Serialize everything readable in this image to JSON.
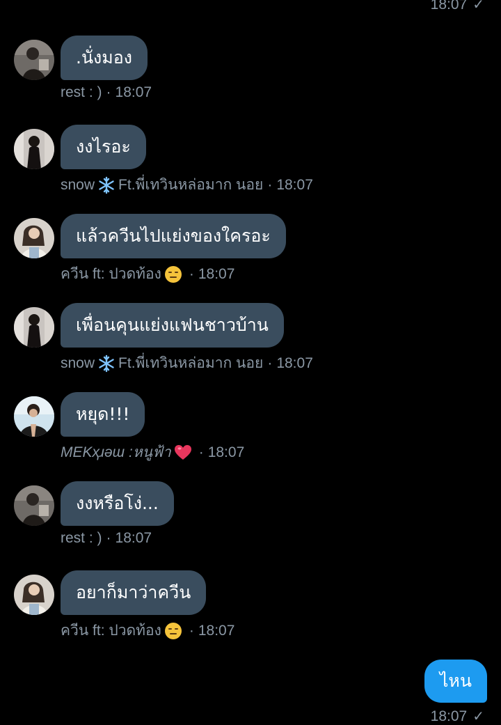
{
  "colors": {
    "background": "#000000",
    "received_bubble": "#3a4d5e",
    "sent_bubble": "#1d9bf0",
    "meta_text": "#8b98a5"
  },
  "top_receipt": {
    "time": "18:07",
    "status_icon": "check-icon"
  },
  "messages": [
    {
      "text": ".นั่งมอง",
      "sender": "rest : )",
      "time": "18:07",
      "avatar": "avatar-icon"
    },
    {
      "text": "งงไรอะ",
      "sender": "snow",
      "sender_suffix": "Ft.พี่เทวินหล่อมาก นอย",
      "emoji": "snowflake-icon",
      "time": "18:07",
      "avatar": "avatar-icon"
    },
    {
      "text": "แล้วควีนไปแย่งของใครอะ",
      "sender": "ควีน ft: ปวดท้อง",
      "emoji": "expressionless-face-icon",
      "time": "18:07",
      "avatar": "avatar-icon"
    },
    {
      "text": "เพื่อนคุนแย่งแฟนชาวบ้าน",
      "sender": "snow",
      "sender_suffix": "Ft.พี่เทวินหล่อมาก นอย",
      "emoji": "snowflake-icon",
      "time": "18:07",
      "avatar": "avatar-icon"
    },
    {
      "text": "หยุด!!!",
      "sender": "MEKҳɹəɯ :หนูฟ้า",
      "emoji": "heart-icon",
      "time": "18:07",
      "avatar": "avatar-icon"
    },
    {
      "text": "งงหรือโง่...",
      "sender": "rest : )",
      "time": "18:07",
      "avatar": "avatar-icon"
    },
    {
      "text": "อยาก็มาว่าควีน",
      "sender": "ควีน ft: ปวดท้อง",
      "emoji": "expressionless-face-icon",
      "time": "18:07",
      "avatar": "avatar-icon"
    }
  ],
  "sent_message": {
    "text": "ไหน",
    "time": "18:07",
    "status_icon": "check-icon"
  },
  "separator": "·"
}
